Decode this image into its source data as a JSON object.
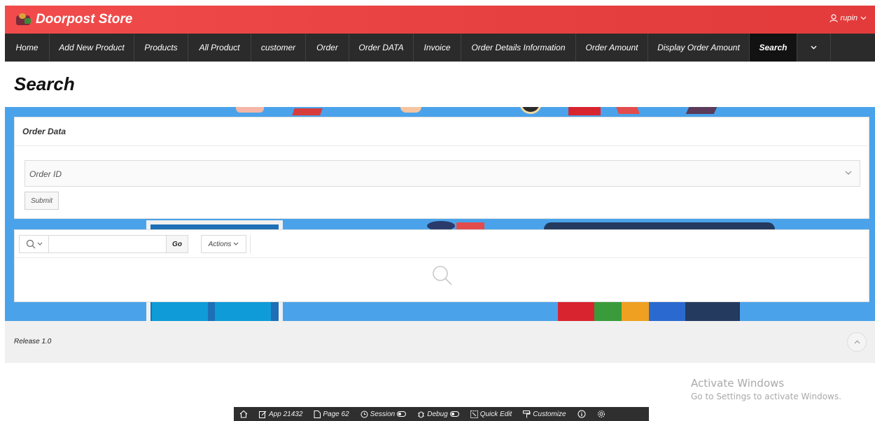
{
  "app": {
    "brand": "Doorpost Store",
    "user": "rupin"
  },
  "nav": {
    "items": [
      {
        "label": "Home",
        "width": 64,
        "active": false
      },
      {
        "label": "Add New Product",
        "width": 121,
        "active": false
      },
      {
        "label": "Products",
        "width": 77,
        "active": false
      },
      {
        "label": "All Product",
        "width": 90,
        "active": false
      },
      {
        "label": "customer",
        "width": 78,
        "active": false
      },
      {
        "label": "Order",
        "width": 62,
        "active": false
      },
      {
        "label": "Order DATA",
        "width": 92,
        "active": false
      },
      {
        "label": "Invoice",
        "width": 68,
        "active": false
      },
      {
        "label": "Order Details Information",
        "width": 164,
        "active": false
      },
      {
        "label": "Order Amount",
        "width": 103,
        "active": false
      },
      {
        "label": "Display Order Amount",
        "width": 145,
        "active": false
      },
      {
        "label": "Search",
        "width": 68,
        "active": true
      }
    ]
  },
  "page": {
    "title": "Search"
  },
  "order_region": {
    "title": "Order Data",
    "select_label": "Order ID",
    "submit_label": "Submit"
  },
  "report": {
    "search_value": "",
    "go_label": "Go",
    "actions_label": "Actions"
  },
  "footer": {
    "release": "Release 1.0"
  },
  "watermark": {
    "line1": "Activate Windows",
    "line2": "Go to Settings to activate Windows."
  },
  "devbar": {
    "app": "App 21432",
    "page": "Page 62",
    "session": "Session",
    "debug": "Debug",
    "quick_edit": "Quick Edit",
    "customize": "Customize"
  },
  "colors": {
    "header": "#e64040",
    "navbar": "#2b2b2b",
    "hero": "#4aa3ea"
  }
}
